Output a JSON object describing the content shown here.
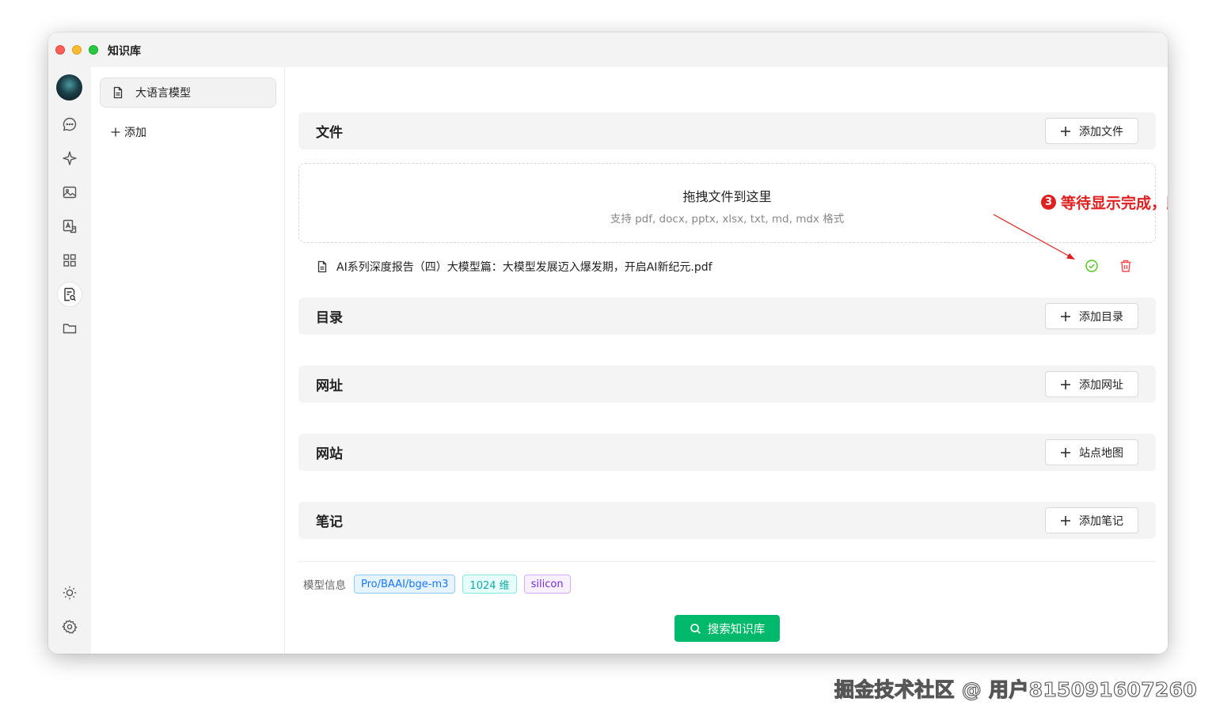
{
  "window": {
    "title": "知识库"
  },
  "sidebar": {
    "knowledge_bases": [
      {
        "name": "大语言模型"
      }
    ],
    "add_label": "添加"
  },
  "iconbar": {
    "items": [
      "chat-icon",
      "sparkle-icon",
      "image-icon",
      "translate-icon",
      "apps-grid-icon",
      "knowledge-icon",
      "folder-icon"
    ],
    "bottom": [
      "theme-icon",
      "settings-icon"
    ],
    "active": "knowledge-icon"
  },
  "sections": {
    "file": {
      "title": "文件",
      "button": "添加文件"
    },
    "directory": {
      "title": "目录",
      "button": "添加目录"
    },
    "url": {
      "title": "网址",
      "button": "添加网址"
    },
    "website": {
      "title": "网站",
      "button": "站点地图"
    },
    "note": {
      "title": "笔记",
      "button": "添加笔记"
    }
  },
  "dropzone": {
    "title": "拖拽文件到这里",
    "subtitle": "支持 pdf, docx, pptx, xlsx, txt, md, mdx 格式"
  },
  "files": [
    {
      "name": "AI系列深度报告（四）大模型篇：大模型发展迈入爆发期，开启AI新纪元.pdf",
      "status": "done"
    }
  ],
  "annotation": {
    "number": "3",
    "text": "等待显示完成，即向量化已成功",
    "color": "#e02020"
  },
  "model_info": {
    "label": "模型信息",
    "model": "Pro/BAAI/bge-m3",
    "dimensions": "1024 维",
    "provider": "silicon"
  },
  "search_button": "搜索知识库",
  "watermark": "掘金技术社区 @ 用户815091607260",
  "colors": {
    "accent": "#00b96b",
    "success": "#52c41a",
    "danger": "#ff4d4f",
    "annotation": "#e02020"
  }
}
